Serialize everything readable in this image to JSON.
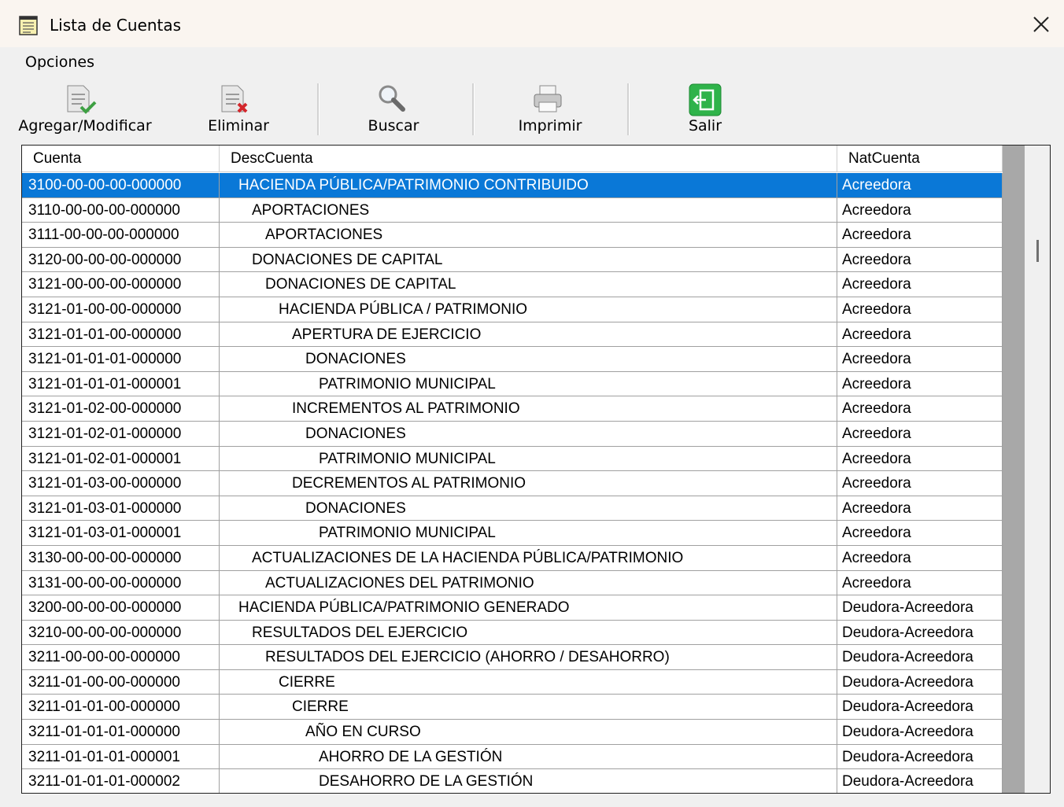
{
  "window": {
    "title": "Lista de Cuentas"
  },
  "menu": {
    "options_label": "Opciones"
  },
  "toolbar": {
    "add_modify": "Agregar/Modificar",
    "delete": "Eliminar",
    "search": "Buscar",
    "print": "Imprimir",
    "exit": "Salir"
  },
  "grid": {
    "columns": [
      "Cuenta",
      "DescCuenta",
      "NatCuenta"
    ],
    "selected_row": 0,
    "rows": [
      {
        "cuenta": "3100-00-00-00-000000",
        "desc": "HACIENDA PÚBLICA/PATRIMONIO CONTRIBUIDO",
        "level": 0,
        "nat": "Acreedora"
      },
      {
        "cuenta": "3110-00-00-00-000000",
        "desc": "APORTACIONES",
        "level": 1,
        "nat": "Acreedora"
      },
      {
        "cuenta": "3111-00-00-00-000000",
        "desc": "APORTACIONES",
        "level": 2,
        "nat": "Acreedora"
      },
      {
        "cuenta": "3120-00-00-00-000000",
        "desc": "DONACIONES DE CAPITAL",
        "level": 1,
        "nat": "Acreedora"
      },
      {
        "cuenta": "3121-00-00-00-000000",
        "desc": "DONACIONES DE CAPITAL",
        "level": 2,
        "nat": "Acreedora"
      },
      {
        "cuenta": "3121-01-00-00-000000",
        "desc": "HACIENDA PÚBLICA / PATRIMONIO",
        "level": 3,
        "nat": "Acreedora"
      },
      {
        "cuenta": "3121-01-01-00-000000",
        "desc": "APERTURA DE EJERCICIO",
        "level": 4,
        "nat": "Acreedora"
      },
      {
        "cuenta": "3121-01-01-01-000000",
        "desc": "DONACIONES",
        "level": 5,
        "nat": "Acreedora"
      },
      {
        "cuenta": "3121-01-01-01-000001",
        "desc": "PATRIMONIO MUNICIPAL",
        "level": 6,
        "nat": "Acreedora"
      },
      {
        "cuenta": "3121-01-02-00-000000",
        "desc": "INCREMENTOS AL PATRIMONIO",
        "level": 4,
        "nat": "Acreedora"
      },
      {
        "cuenta": "3121-01-02-01-000000",
        "desc": "DONACIONES",
        "level": 5,
        "nat": "Acreedora"
      },
      {
        "cuenta": "3121-01-02-01-000001",
        "desc": "PATRIMONIO MUNICIPAL",
        "level": 6,
        "nat": "Acreedora"
      },
      {
        "cuenta": "3121-01-03-00-000000",
        "desc": "DECREMENTOS AL PATRIMONIO",
        "level": 4,
        "nat": "Acreedora"
      },
      {
        "cuenta": "3121-01-03-01-000000",
        "desc": "DONACIONES",
        "level": 5,
        "nat": "Acreedora"
      },
      {
        "cuenta": "3121-01-03-01-000001",
        "desc": "PATRIMONIO MUNICIPAL",
        "level": 6,
        "nat": "Acreedora"
      },
      {
        "cuenta": "3130-00-00-00-000000",
        "desc": "ACTUALIZACIONES DE LA HACIENDA PÚBLICA/PATRIMONIO",
        "level": 1,
        "nat": "Acreedora"
      },
      {
        "cuenta": "3131-00-00-00-000000",
        "desc": "ACTUALIZACIONES DEL PATRIMONIO",
        "level": 2,
        "nat": "Acreedora"
      },
      {
        "cuenta": "3200-00-00-00-000000",
        "desc": "HACIENDA PÚBLICA/PATRIMONIO GENERADO",
        "level": 0,
        "nat": "Deudora-Acreedora"
      },
      {
        "cuenta": "3210-00-00-00-000000",
        "desc": "RESULTADOS DEL EJERCICIO",
        "level": 1,
        "nat": "Deudora-Acreedora"
      },
      {
        "cuenta": "3211-00-00-00-000000",
        "desc": "RESULTADOS DEL EJERCICIO (AHORRO / DESAHORRO)",
        "level": 2,
        "nat": "Deudora-Acreedora"
      },
      {
        "cuenta": "3211-01-00-00-000000",
        "desc": "CIERRE",
        "level": 3,
        "nat": "Deudora-Acreedora"
      },
      {
        "cuenta": "3211-01-01-00-000000",
        "desc": "CIERRE",
        "level": 4,
        "nat": "Deudora-Acreedora"
      },
      {
        "cuenta": "3211-01-01-01-000000",
        "desc": "AÑO EN CURSO",
        "level": 5,
        "nat": "Deudora-Acreedora"
      },
      {
        "cuenta": "3211-01-01-01-000001",
        "desc": "AHORRO DE LA GESTIÓN",
        "level": 6,
        "nat": "Deudora-Acreedora"
      },
      {
        "cuenta": "3211-01-01-01-000002",
        "desc": "DESAHORRO DE LA GESTIÓN",
        "level": 6,
        "nat": "Deudora-Acreedora"
      }
    ]
  },
  "icons": {
    "app": "notepad-icon",
    "close": "close-icon",
    "add_modify": "document-check-icon",
    "delete": "document-delete-icon",
    "search": "magnifier-icon",
    "print": "printer-icon",
    "exit": "exit-door-icon"
  },
  "colors": {
    "selection": "#0a78d7",
    "exit_button": "#2fb34a"
  }
}
